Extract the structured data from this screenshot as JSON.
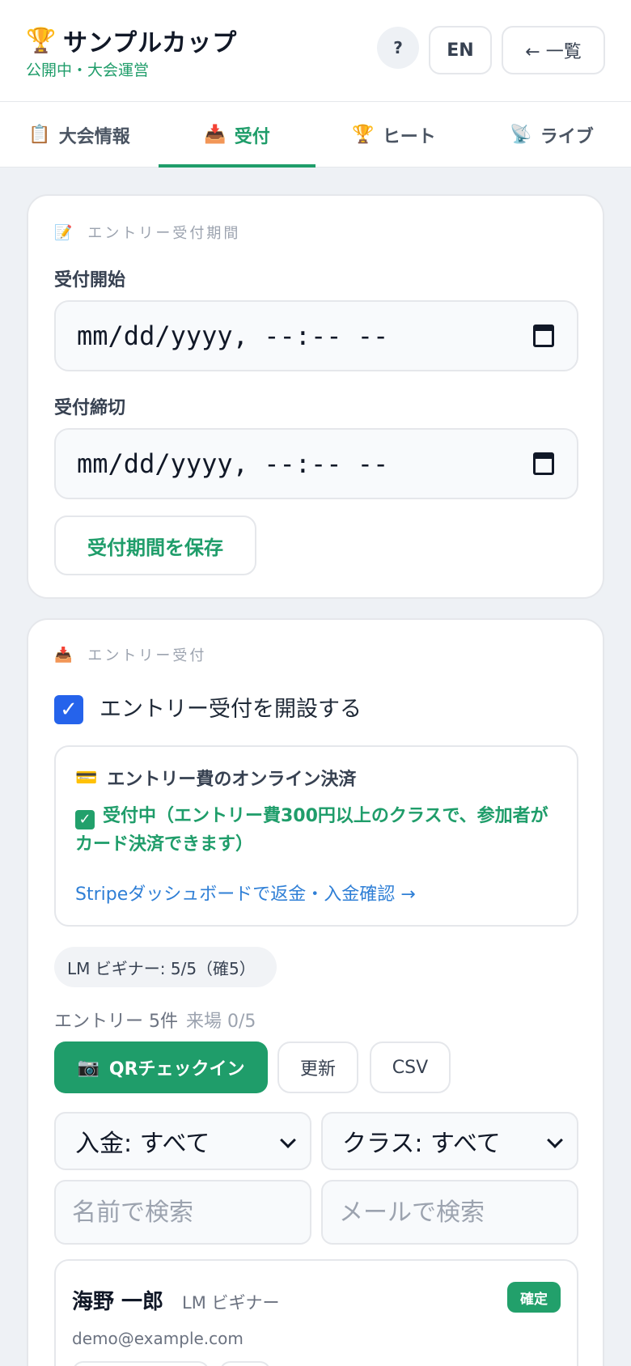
{
  "header": {
    "title": "サンプルカップ",
    "subtitle": "公開中・大会運営",
    "help_label": "?",
    "lang_label": "EN",
    "back_label": "← 一覧"
  },
  "tabs": [
    {
      "icon": "📋",
      "label": "大会情報"
    },
    {
      "icon": "📥",
      "label": "受付"
    },
    {
      "icon": "🏆",
      "label": "ヒート"
    },
    {
      "icon": "📡",
      "label": "ライブ"
    }
  ],
  "period_card": {
    "icon": "📝",
    "section_title": "エントリー受付期間",
    "start_label": "受付開始",
    "start_value": "mm/dd/yyyy, --:-- --",
    "end_label": "受付締切",
    "end_value": "mm/dd/yyyy, --:-- --",
    "save_label": "受付期間を保存"
  },
  "entry_card": {
    "icon": "📥",
    "section_title": "エントリー受付",
    "open_checkbox_label": "エントリー受付を開設する",
    "open_checked": true,
    "payment": {
      "icon": "💳",
      "title": "エントリー費のオンライン決済",
      "status": "受付中（エントリー費300円以上のクラスで、参加者がカード決済できます）",
      "link": "Stripeダッシュボードで返金・入金確認 →"
    },
    "class_chip": "LM ビギナー: 5/5（確5）",
    "count_text": "エントリー 5件",
    "checkin_text": "来場 0/5",
    "qr_icon": "📷",
    "qr_label": "QRチェックイン",
    "refresh_label": "更新",
    "csv_label": "CSV",
    "filter_payment": "入金: すべて",
    "filter_class": "クラス: すべて",
    "search_name_placeholder": "名前で検索",
    "search_email_placeholder": "メールで検索",
    "entries": [
      {
        "name": "海野 一郎",
        "class": "LM ビギナー",
        "status": "確定",
        "email": "demo@example.com"
      }
    ]
  },
  "colors": {
    "accent": "#1f9d6a",
    "link": "#2f7fd6",
    "checkbox": "#2563eb",
    "background": "#eef1f5"
  }
}
